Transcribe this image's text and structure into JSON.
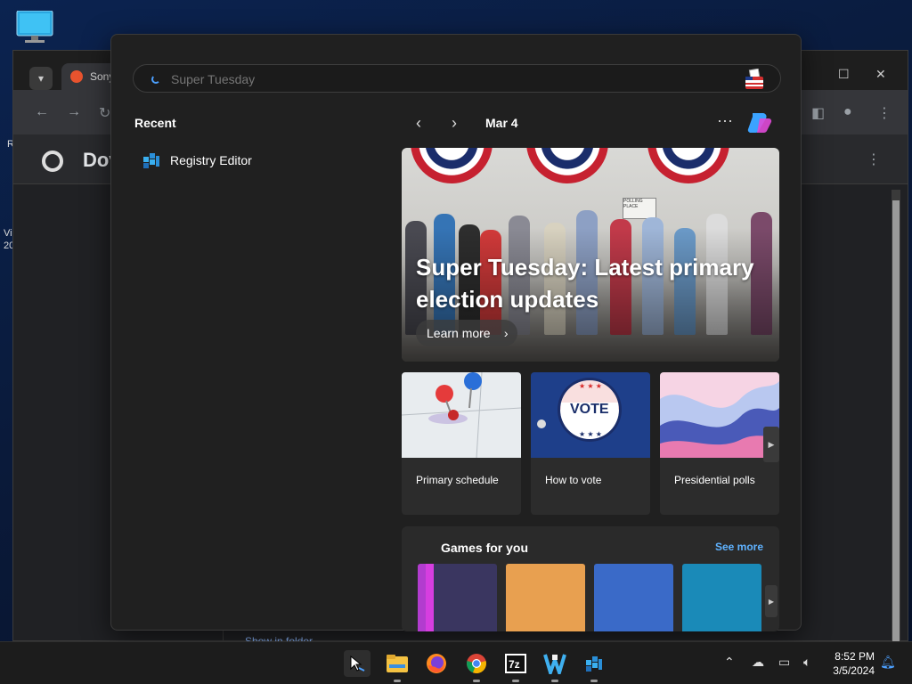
{
  "colors": {
    "accent": "#5fb2ff",
    "flyout_bg": "#202020",
    "taskbar_bg": "#1c1c1c"
  },
  "background_window": {
    "tab_title": "Sony",
    "page_header": "Dov",
    "footer_link": "Show in folder"
  },
  "search": {
    "placeholder": "Super Tuesday",
    "value": "",
    "icon": "ballot-box-icon"
  },
  "recent": {
    "title": "Recent",
    "items": [
      {
        "label": "Registry Editor",
        "icon": "registry-editor-icon"
      }
    ]
  },
  "feed_nav": {
    "date": "Mar 4",
    "prev_icon": "chevron-left-icon",
    "next_icon": "chevron-right-icon",
    "more_icon": "more-icon",
    "copilot_icon": "copilot-icon"
  },
  "hero": {
    "title": "Super Tuesday: Latest primary election updates",
    "button": "Learn more",
    "sign_text": "POLLING PLACE"
  },
  "cards": [
    {
      "label": "Primary schedule",
      "icon": "calendar-pins-image"
    },
    {
      "label": "How to vote",
      "icon": "vote-button-image",
      "badge_text": "VOTE"
    },
    {
      "label": "Presidential polls",
      "icon": "polls-chart-image"
    }
  ],
  "games": {
    "title": "Games for you",
    "see_more": "See more"
  },
  "taskbar": {
    "apps": [
      "search",
      "file-explorer",
      "firefox",
      "chrome",
      "7zip",
      "app",
      "registry-editor"
    ],
    "time": "8:52 PM",
    "date": "3/5/2024"
  }
}
